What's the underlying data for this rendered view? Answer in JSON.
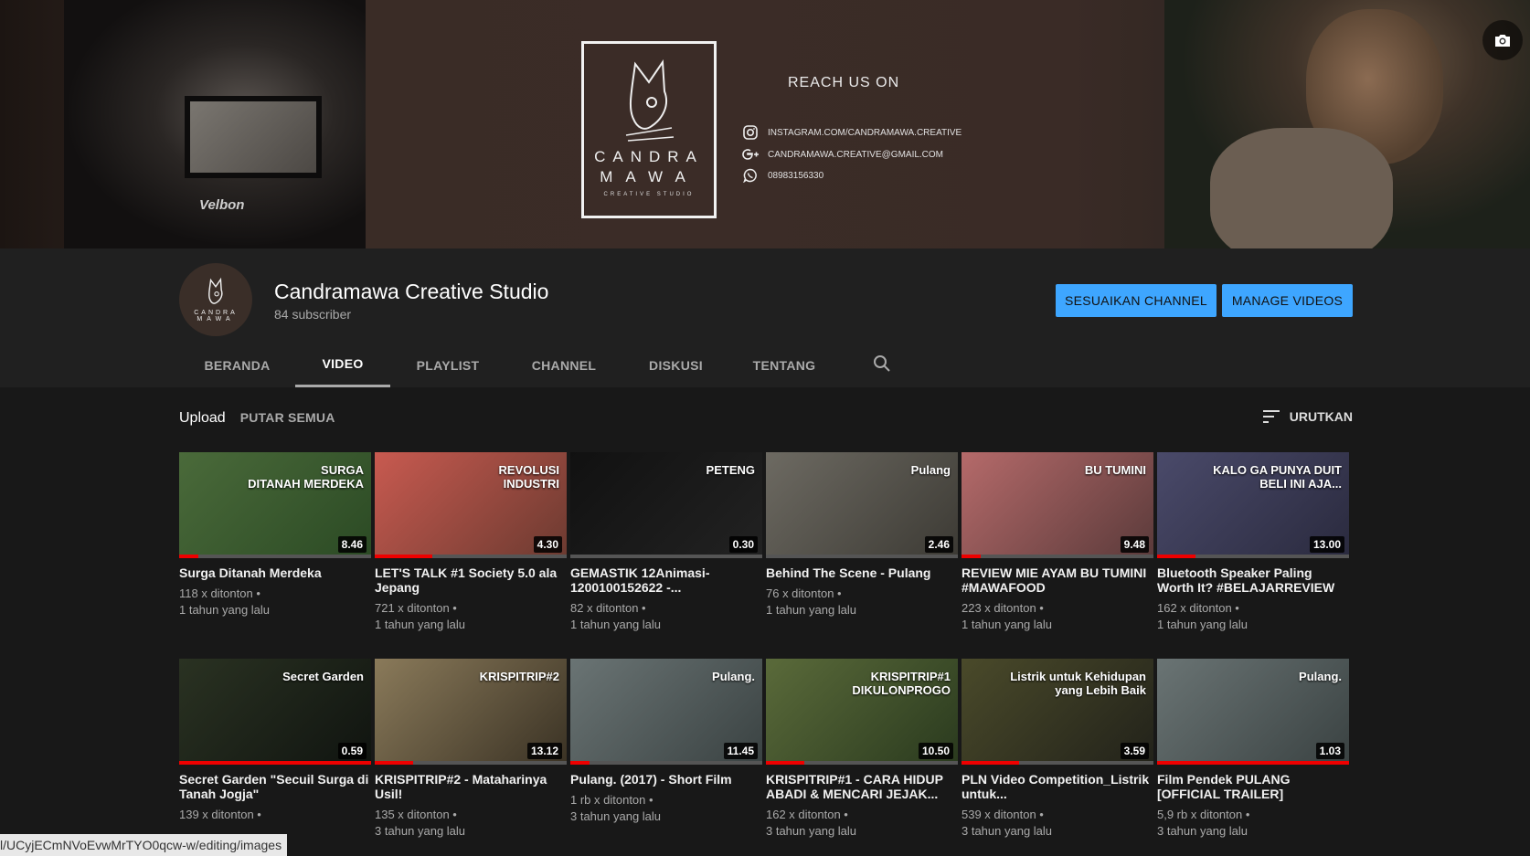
{
  "banner": {
    "camera_brand": "Velbon",
    "logo_line1": "CANDRA",
    "logo_line2": "MAWA",
    "logo_line3": "CREATIVE STUDIO",
    "reach_title": "REACH US ON",
    "contacts": [
      {
        "icon": "instagram-icon",
        "text": "INSTAGRAM.COM/CANDRAMAWA.CREATIVE"
      },
      {
        "icon": "google-plus-icon",
        "text": "CANDRAMAWA.CREATIVE@GMAIL.COM"
      },
      {
        "icon": "whatsapp-icon",
        "text": "08983156330"
      }
    ]
  },
  "channel": {
    "name": "Candramawa Creative Studio",
    "subscribers": "84 subscriber",
    "avatar_line1": "CANDRA",
    "avatar_line2": "MAWA",
    "customize_label": "SESUAIKAN CHANNEL",
    "manage_label": "MANAGE VIDEOS"
  },
  "tabs": [
    "BERANDA",
    "VIDEO",
    "PLAYLIST",
    "CHANNEL",
    "DISKUSI",
    "TENTANG"
  ],
  "active_tab": "VIDEO",
  "toolbar": {
    "upload": "Upload",
    "play_all": "PUTAR SEMUA",
    "sort": "URUTKAN"
  },
  "videos": [
    {
      "title": "Surga Ditanah Merdeka",
      "views": "118 x ditonton",
      "age": "1 tahun yang lalu",
      "duration": "8.46",
      "thumb_text": "SURGA\nDITANAH MERDEKA",
      "progress": 0.1,
      "colors": [
        "#4a6a3a",
        "#2b4a24"
      ]
    },
    {
      "title": "LET'S TALK #1 Society 5.0 ala Jepang",
      "views": "721 x ditonton",
      "age": "1 tahun yang lalu",
      "duration": "4.30",
      "thumb_text": "REVOLUSI\nINDUSTRI",
      "progress": 0.3,
      "colors": [
        "#c85a50",
        "#6b3a30"
      ]
    },
    {
      "title": "GEMASTIK 12Animasi-1200100152622 -...",
      "views": "82 x ditonton",
      "age": "1 tahun yang lalu",
      "duration": "0.30",
      "thumb_text": "PETENG",
      "progress": 0,
      "colors": [
        "#111111",
        "#222222"
      ]
    },
    {
      "title": "Behind The Scene - Pulang",
      "views": "76 x ditonton",
      "age": "1 tahun yang lalu",
      "duration": "2.46",
      "thumb_text": "Pulang",
      "progress": 0,
      "colors": [
        "#6d6a62",
        "#3c3a34"
      ]
    },
    {
      "title": "REVIEW MIE AYAM BU TUMINI #MAWAFOOD",
      "views": "223 x ditonton",
      "age": "1 tahun yang lalu",
      "duration": "9.48",
      "thumb_text": "BU TUMINI",
      "progress": 0.1,
      "colors": [
        "#b56a6a",
        "#5a3a3a"
      ]
    },
    {
      "title": "Bluetooth Speaker Paling Worth It? #BELAJARREVIEW",
      "views": "162 x ditonton",
      "age": "1 tahun yang lalu",
      "duration": "13.00",
      "thumb_text": "KALO GA PUNYA DUIT\nBELI INI AJA...",
      "progress": 0.2,
      "colors": [
        "#4a4a6a",
        "#2a2a3e"
      ]
    },
    {
      "title": "Secret Garden \"Secuil Surga di Tanah Jogja\"",
      "views": "139 x ditonton",
      "age": "",
      "duration": "0.59",
      "thumb_text": "Secret Garden",
      "progress": 1.0,
      "colors": [
        "#2a3222",
        "#101410"
      ]
    },
    {
      "title": "KRISPITRIP#2 - Mataharinya Usil!",
      "views": "135 x ditonton",
      "age": "3 tahun yang lalu",
      "duration": "13.12",
      "thumb_text": "KRISPITRIP#2",
      "progress": 0.2,
      "colors": [
        "#8a7a5a",
        "#3a3224"
      ]
    },
    {
      "title": "Pulang. (2017) - Short Film",
      "views": "1 rb x ditonton",
      "age": "3 tahun yang lalu",
      "duration": "11.45",
      "thumb_text": "Pulang.",
      "progress": 0.1,
      "colors": [
        "#6a7474",
        "#3a4242"
      ]
    },
    {
      "title": "KRISPITRIP#1 - CARA HIDUP ABADI & MENCARI JEJAK...",
      "views": "162 x ditonton",
      "age": "3 tahun yang lalu",
      "duration": "10.50",
      "thumb_text": "KRISPITRIP#1\nDIKULONPROGO",
      "progress": 0.2,
      "colors": [
        "#5a6a3a",
        "#2a3a1e"
      ]
    },
    {
      "title": "PLN Video Competition_Listrik untuk...",
      "views": "539 x ditonton",
      "age": "3 tahun yang lalu",
      "duration": "3.59",
      "thumb_text": "Listrik untuk Kehidupan\nyang Lebih Baik",
      "progress": 0.3,
      "colors": [
        "#4a4a2a",
        "#22221a"
      ]
    },
    {
      "title": "Film Pendek PULANG [OFFICIAL TRAILER]",
      "views": "5,9 rb x ditonton",
      "age": "3 tahun yang lalu",
      "duration": "1.03",
      "thumb_text": "Pulang.",
      "progress": 1.0,
      "colors": [
        "#6a7474",
        "#3a4242"
      ]
    }
  ],
  "status_url": "l/UCyjECmNVoEvwMrTYO0qcw-w/editing/images"
}
